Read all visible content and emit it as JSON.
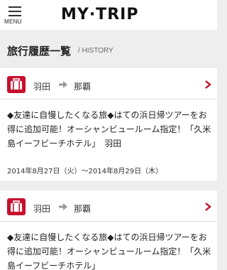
{
  "header": {
    "menu_label": "MENU",
    "logo": "MY·TRIP"
  },
  "page": {
    "title": "旅行履歴一覧",
    "subtitle": "/ HISTORY"
  },
  "trips": [
    {
      "from": "羽田",
      "to": "那覇",
      "description": "◆友達に自慢したくなる旅◆はての浜日帰ツアーをお得に追加可能！オーシャンビュールーム指定！「久米島イーフビーチホテル」　羽田",
      "dates": "2014年8月27日（火）〜2014年8月29日（木）"
    },
    {
      "from": "羽田",
      "to": "那覇",
      "description": "◆友達に自慢したくなる旅◆はての浜日帰ツアーをお得に追加可能！オーシャンビュールーム指定！「久米島イーフビーチホテル」",
      "dates": ""
    }
  ],
  "colors": {
    "accent": "#c8102e",
    "background": "#eeeeee"
  }
}
